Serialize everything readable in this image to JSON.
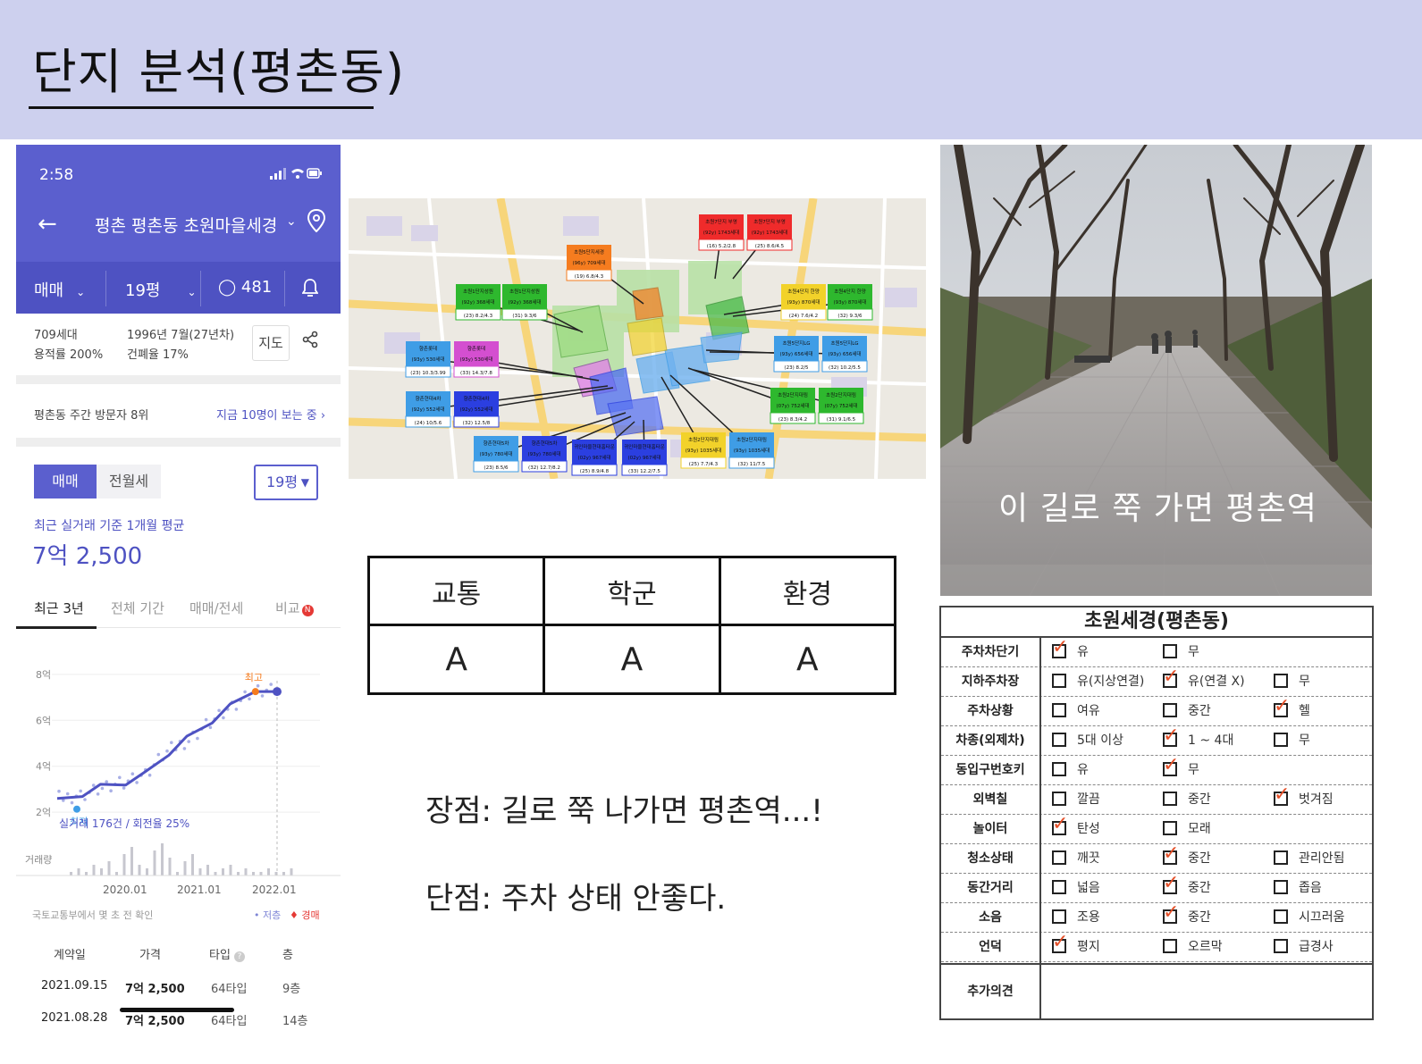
{
  "slide": {
    "title": "단지 분석(평촌동)"
  },
  "phone": {
    "status_time": "2:58",
    "nav_title": "평촌 평촌동 초원마을세경",
    "tabs": {
      "trade_type": "매매",
      "size": "19평",
      "comments": "481"
    },
    "info": {
      "households": "709세대",
      "far": "용적률 200%",
      "built": "1996년 7월(27년차)",
      "bcr": "건폐율 17%",
      "map_button": "지도"
    },
    "visitors": {
      "left": "평촌동 주간 방문자 8위",
      "right": "지금 10명이 보는 중"
    },
    "segment": {
      "a": "매매",
      "b": "전월세"
    },
    "size_dropdown": "19평",
    "avg_label": "최근 실거래 기준 1개월 평균",
    "avg_price": "7억 2,500",
    "period_tabs": [
      "최근 3년",
      "전체 기간",
      "매매/전세",
      "비교"
    ],
    "period_badge": "N",
    "chart_labels": {
      "y": [
        "8억",
        "6억",
        "4억",
        "2억"
      ],
      "max": "최고",
      "min": "최저",
      "summary": "실거래 176건 / 회전율 25%",
      "volume": "거래량",
      "x": [
        "2020.01",
        "2021.01",
        "2022.01"
      ],
      "source": "국토교통부에서 몇 초 전 확인",
      "legend_low": "저층",
      "legend_auction": "경매"
    },
    "table": {
      "headers": [
        "계약일",
        "가격",
        "타입",
        "층"
      ],
      "rows": [
        [
          "2021.09.15",
          "7억 2,500",
          "64타입",
          "9층"
        ],
        [
          "2021.08.28",
          "7억 2,500",
          "64타입",
          "14층"
        ]
      ]
    }
  },
  "chart_data": {
    "type": "line",
    "title": "",
    "ylabel": "",
    "ylim": [
      1.5,
      8.5
    ],
    "x": [
      "2019.07",
      "2019.10",
      "2020.01",
      "2020.04",
      "2020.07",
      "2020.10",
      "2021.01",
      "2021.04",
      "2021.07",
      "2021.10",
      "2022.01"
    ],
    "series": [
      {
        "values": [
          2.6,
          2.8,
          3.1,
          3.3,
          3.6,
          4.6,
          5.2,
          6.0,
          6.6,
          7.25,
          7.25
        ]
      }
    ],
    "volume": [
      1,
      2,
      1,
      3,
      2,
      4,
      1,
      6,
      8,
      3,
      2,
      7,
      9,
      5,
      1,
      4,
      6,
      2,
      3,
      1,
      2,
      3,
      1,
      2,
      1,
      1,
      2,
      1,
      1,
      2
    ]
  },
  "map": {
    "labels": [
      {
        "name": "초원7단지 부영",
        "info": "(92y) 1743세대",
        "size": "(16) 5.2/2.8",
        "color": "#ef2b2b"
      },
      {
        "name": "초원7단지 부영",
        "info": "(92y) 1743세대",
        "size": "(25) 8.6/4.5",
        "color": "#ef2b2b"
      },
      {
        "name": "초원5단지세경",
        "info": "(96y) 709세대",
        "size": "(19) 6.8/4.3",
        "color": "#f57c1f"
      },
      {
        "name": "초원1단지성원",
        "info": "(92y) 368세대",
        "size": "(23) 8.2/4.3",
        "color": "#2eb82e"
      },
      {
        "name": "초원1단지성원",
        "info": "(92y) 368세대",
        "size": "(31) 9.3/6",
        "color": "#2eb82e"
      },
      {
        "name": "초원4단지 한양",
        "info": "(93y) 870세대",
        "size": "(24) 7.6/4.2",
        "color": "#f2d22a"
      },
      {
        "name": "초원4단지 한양",
        "info": "(93y) 870세대",
        "size": "(32) 9.3/6",
        "color": "#2eb82e"
      },
      {
        "name": "향촌롯데",
        "info": "(93y) 530세대",
        "size": "(23) 10.3/3.99",
        "color": "#3f9de6"
      },
      {
        "name": "향촌롯데",
        "info": "(93y) 530세대",
        "size": "(33) 14.3/7.8",
        "color": "#d44fd0"
      },
      {
        "name": "초원5단지LG",
        "info": "(93y) 656세대",
        "size": "(23) 8.2/5",
        "color": "#3f9de6"
      },
      {
        "name": "초원5단지LG",
        "info": "(93y) 656세대",
        "size": "(32) 10.2/5.5",
        "color": "#3f9de6"
      },
      {
        "name": "향촌현대4차",
        "info": "(92y) 552세대",
        "size": "(24) 10/5.6",
        "color": "#3f9de6"
      },
      {
        "name": "향촌현대4차",
        "info": "(92y) 552세대",
        "size": "(32) 12.5/8",
        "color": "#2b3fe0"
      },
      {
        "name": "초원2단지대림",
        "info": "(07y) 752세대",
        "size": "(23) 8.3/4.2",
        "color": "#2eb82e"
      },
      {
        "name": "초원2단지대림",
        "info": "(07y) 752세대",
        "size": "(31) 9.1/6.5",
        "color": "#2eb82e"
      },
      {
        "name": "향촌현대5차",
        "info": "(93y) 780세대",
        "size": "(23) 8.5/6",
        "color": "#3f9de6"
      },
      {
        "name": "향촌현대5차",
        "info": "(93y) 780세대",
        "size": "(32) 12.7/8.2",
        "color": "#2b3fe0"
      },
      {
        "name": "귀인마을현대홈타운",
        "info": "(02y) 967세대",
        "size": "(25) 8.9/4.8",
        "color": "#2b3fe0"
      },
      {
        "name": "귀인마을현대홈타운",
        "info": "(02y) 967세대",
        "size": "(33) 12.2/7.5",
        "color": "#2b3fe0"
      },
      {
        "name": "초원2단지대림",
        "info": "(93y) 1035세대",
        "size": "(25) 7.7/4.3",
        "color": "#f2d22a"
      },
      {
        "name": "초원2단지대림",
        "info": "(93y) 1035세대",
        "size": "(32) 11/7.5",
        "color": "#3f9de6"
      }
    ]
  },
  "ratings": {
    "headers": [
      "교통",
      "학군",
      "환경"
    ],
    "values": [
      "A",
      "A",
      "A"
    ]
  },
  "notes": {
    "pros": "장점: 길로 쭉 나가면 평촌역...!",
    "cons": "단점: 주차 상태 안좋다."
  },
  "photo": {
    "caption": "이 길로 쭉 가면 평촌역"
  },
  "checklist": {
    "title": "초원세경(평촌동)",
    "rows": [
      {
        "label": "주차차단기",
        "options": [
          {
            "text": "유",
            "checked": true
          },
          {
            "text": "무",
            "checked": false
          }
        ]
      },
      {
        "label": "지하주차장",
        "options": [
          {
            "text": "유(지상연결)",
            "checked": false
          },
          {
            "text": "유(연결 X)",
            "checked": true
          },
          {
            "text": "무",
            "checked": false
          }
        ]
      },
      {
        "label": "주차상황",
        "options": [
          {
            "text": "여유",
            "checked": false
          },
          {
            "text": "중간",
            "checked": false
          },
          {
            "text": "헬",
            "checked": true
          }
        ]
      },
      {
        "label": "차종(외제차)",
        "options": [
          {
            "text": "5대 이상",
            "checked": false
          },
          {
            "text": "1 ~ 4대",
            "checked": true
          },
          {
            "text": "무",
            "checked": false
          }
        ]
      },
      {
        "label": "동입구번호키",
        "options": [
          {
            "text": "유",
            "checked": false
          },
          {
            "text": "무",
            "checked": true
          }
        ]
      },
      {
        "label": "외벽칠",
        "options": [
          {
            "text": "깔끔",
            "checked": false
          },
          {
            "text": "중간",
            "checked": false
          },
          {
            "text": "벗겨짐",
            "checked": true
          }
        ]
      },
      {
        "label": "놀이터",
        "options": [
          {
            "text": "탄성",
            "checked": true
          },
          {
            "text": "모래",
            "checked": false
          }
        ]
      },
      {
        "label": "청소상태",
        "options": [
          {
            "text": "깨끗",
            "checked": false
          },
          {
            "text": "중간",
            "checked": true
          },
          {
            "text": "관리안됨",
            "checked": false
          }
        ]
      },
      {
        "label": "동간거리",
        "options": [
          {
            "text": "넓음",
            "checked": false
          },
          {
            "text": "중간",
            "checked": true
          },
          {
            "text": "좁음",
            "checked": false
          }
        ]
      },
      {
        "label": "소음",
        "options": [
          {
            "text": "조용",
            "checked": false
          },
          {
            "text": "중간",
            "checked": true
          },
          {
            "text": "시끄러움",
            "checked": false
          }
        ]
      },
      {
        "label": "언덕",
        "options": [
          {
            "text": "평지",
            "checked": true
          },
          {
            "text": "오르막",
            "checked": false
          },
          {
            "text": "급경사",
            "checked": false
          }
        ]
      }
    ],
    "extra_label": "추가의견"
  }
}
